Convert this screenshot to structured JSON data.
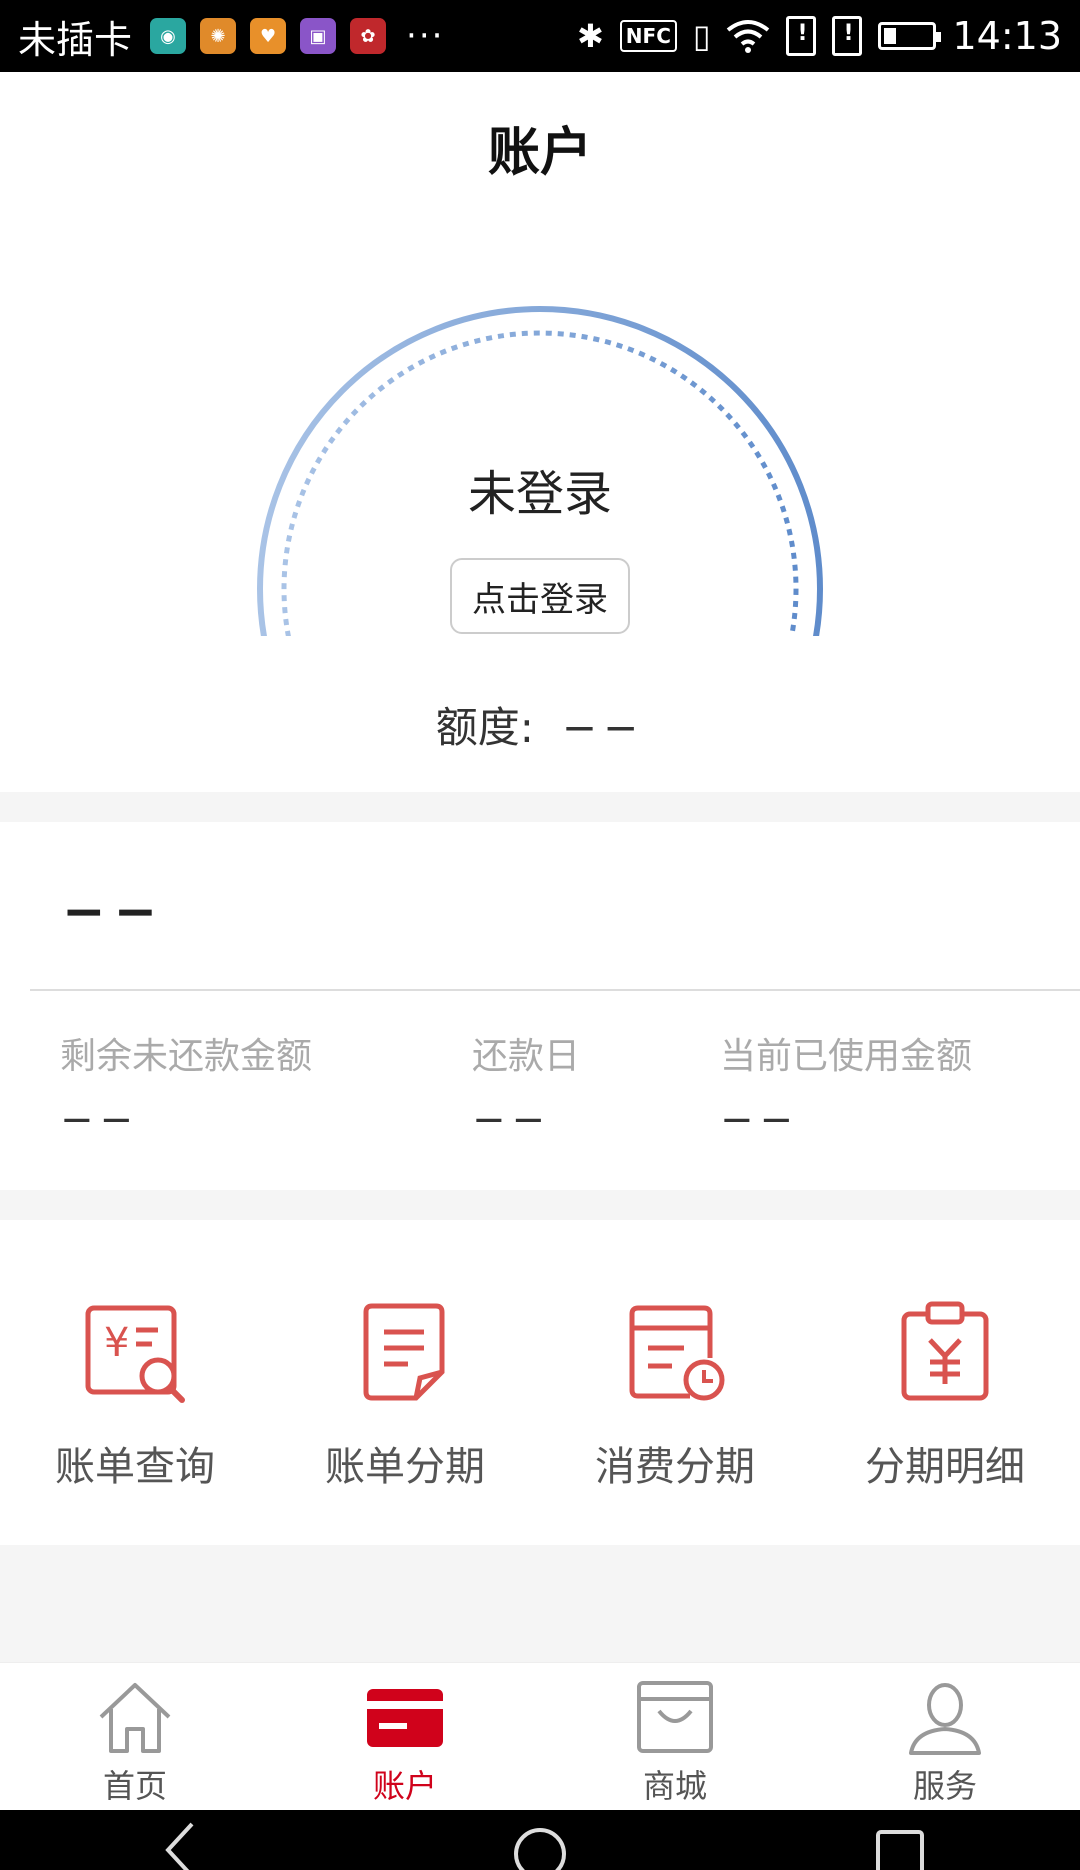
{
  "status_bar": {
    "carrier": "未插卡",
    "more": "···",
    "nfc": "NFC",
    "time": "14:13"
  },
  "header": {
    "title": "账户"
  },
  "login": {
    "status": "未登录",
    "button_label": "点击登录",
    "credit_label": "额度:",
    "credit_value": "−−"
  },
  "bill": {
    "amount": "−−",
    "stats": [
      {
        "label": "剩余未还款金额",
        "value": "−−"
      },
      {
        "label": "还款日",
        "value": "−−"
      },
      {
        "label": "当前已使用金额",
        "value": "−−"
      }
    ]
  },
  "functions": [
    {
      "label": "账单查询",
      "icon": "bill-search-icon"
    },
    {
      "label": "账单分期",
      "icon": "bill-installment-icon"
    },
    {
      "label": "消费分期",
      "icon": "consumption-installment-icon"
    },
    {
      "label": "分期明细",
      "icon": "installment-detail-icon"
    }
  ],
  "tabs": [
    {
      "label": "首页",
      "icon": "home-icon",
      "active": false
    },
    {
      "label": "账户",
      "icon": "card-icon",
      "active": true
    },
    {
      "label": "商城",
      "icon": "shopping-bag-icon",
      "active": false
    },
    {
      "label": "服务",
      "icon": "person-icon",
      "active": false
    }
  ],
  "colors": {
    "accent": "#d0021b",
    "icon_red": "#d9534f",
    "ring_blue": "#6a95cf"
  }
}
